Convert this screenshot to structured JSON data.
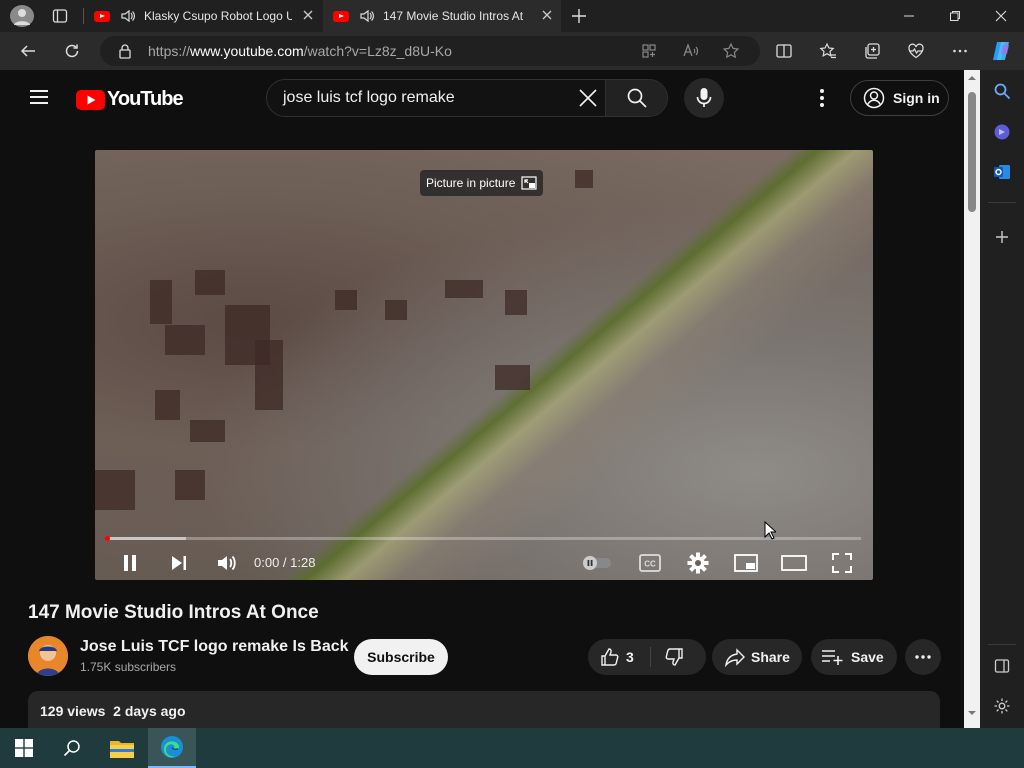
{
  "browser": {
    "tabs": [
      {
        "title": "Klasky Csupo Robot Logo U",
        "active": false
      },
      {
        "title": "147 Movie Studio Intros At ",
        "active": true
      }
    ],
    "url_prefix": "https://",
    "url_domain": "www.youtube.com",
    "url_path": "/watch?v=Lz8z_d8U-Ko"
  },
  "youtube": {
    "logo_text": "YouTube",
    "search_value": "jose luis tcf logo remake",
    "sign_in_label": "Sign in"
  },
  "player": {
    "pip_tooltip": "Picture in picture",
    "time": "0:00 / 1:28",
    "progress_fraction": 0.0,
    "buffered_fraction": 0.105
  },
  "video": {
    "title": "147 Movie Studio Intros At Once",
    "channel_name": "Jose Luis TCF logo remake Is Back",
    "subscribers": "1.75K subscribers",
    "subscribe_label": "Subscribe",
    "likes": "3",
    "share_label": "Share",
    "save_label": "Save",
    "views": "129 views",
    "posted": "2 days ago"
  },
  "colors": {
    "accent": "#ff0000",
    "page_bg": "#0f0f0f",
    "taskbar": "#1f3b3d"
  }
}
